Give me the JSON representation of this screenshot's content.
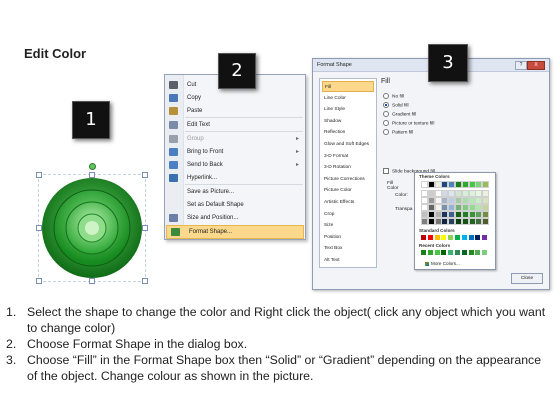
{
  "title": "Edit Color",
  "badges": [
    "1",
    "2",
    "3"
  ],
  "context_menu": {
    "items": [
      {
        "label": "Cut",
        "icon": "scissors-icon",
        "color": "#5a5f6b"
      },
      {
        "label": "Copy",
        "icon": "copy-icon",
        "color": "#4a78b8"
      },
      {
        "label": "Paste",
        "icon": "paste-icon",
        "color": "#b8903a"
      },
      {
        "label": "Edit Text",
        "icon": "edit-text-icon",
        "color": "#7a8aa8"
      },
      {
        "label": "Group",
        "icon": "group-icon",
        "color": "#9aa0ab",
        "disabled": true,
        "submenu": true
      },
      {
        "label": "Bring to Front",
        "icon": "bring-front-icon",
        "color": "#4d7fc4",
        "submenu": true
      },
      {
        "label": "Send to Back",
        "icon": "send-back-icon",
        "color": "#4d7fc4",
        "submenu": true
      },
      {
        "label": "Hyperlink...",
        "icon": "hyperlink-icon",
        "color": "#3a6fb0"
      },
      {
        "label": "Save as Picture...",
        "icon": "",
        "color": ""
      },
      {
        "label": "Set as Default Shape",
        "icon": "",
        "color": ""
      },
      {
        "label": "Size and Position...",
        "icon": "size-icon",
        "color": "#6b7fa8"
      },
      {
        "label": "Format Shape...",
        "icon": "format-shape-icon",
        "color": "#3d8a3d",
        "highlighted": true
      }
    ]
  },
  "dialog": {
    "title": "Format Shape",
    "help": "?",
    "close_x": "X",
    "categories": [
      "Fill",
      "Line Color",
      "Line Style",
      "Shadow",
      "Reflection",
      "Glow and Soft Edges",
      "3-D Format",
      "3-D Rotation",
      "Picture Corrections",
      "Picture Color",
      "Artistic Effects",
      "Crop",
      "Size",
      "Position",
      "Text Box",
      "Alt Text"
    ],
    "selected_category": "Fill",
    "fill_heading": "Fill",
    "fill_options": [
      {
        "label": "No fill",
        "selected": false
      },
      {
        "label": "Solid fill",
        "selected": true
      },
      {
        "label": "Gradient fill",
        "selected": false
      },
      {
        "label": "Picture or texture fill",
        "selected": false
      },
      {
        "label": "Pattern fill",
        "selected": false
      }
    ],
    "slide_bg": "Slide background fill",
    "fill_color_label": "Fill Color",
    "color_label": "Color:",
    "transparency_label": "Transpa",
    "close_button": "Close"
  },
  "palette": {
    "theme_heading": "Theme Colors",
    "standard_heading": "Standard Colors",
    "recent_heading": "Recent Colors",
    "more_colors": "More Colors...",
    "theme_columns": [
      "#ffffff",
      "#000000",
      "#eeece1",
      "#1f497d",
      "#4f81bd",
      "#1a7f1a",
      "#2fa82f",
      "#49c549",
      "#7fd37f",
      "#9bbb59"
    ],
    "standard_colors": [
      "#c00000",
      "#ff0000",
      "#ffc000",
      "#ffff00",
      "#92d050",
      "#00b050",
      "#00b0f0",
      "#0070c0",
      "#002060",
      "#7030a0"
    ],
    "recent_colors": [
      "#1a7f1a",
      "#2fa82f",
      "#49c549",
      "#006400",
      "#3cb371",
      "#2e8b57",
      "#0b6623",
      "#228b22",
      "#55aa55",
      "#7ccd7c"
    ]
  },
  "instructions": [
    {
      "num": "1.",
      "text": "Select the shape to change the color and Right click the object( click any object which you want to change color)"
    },
    {
      "num": "2.",
      "text": "Choose Format Shape in the dialog box."
    },
    {
      "num": "3.",
      "text": "Choose “Fill” in the Format Shape box then “Solid” or “Gradient” depending on the appearance of the object. Change colour as shown in the picture."
    }
  ]
}
